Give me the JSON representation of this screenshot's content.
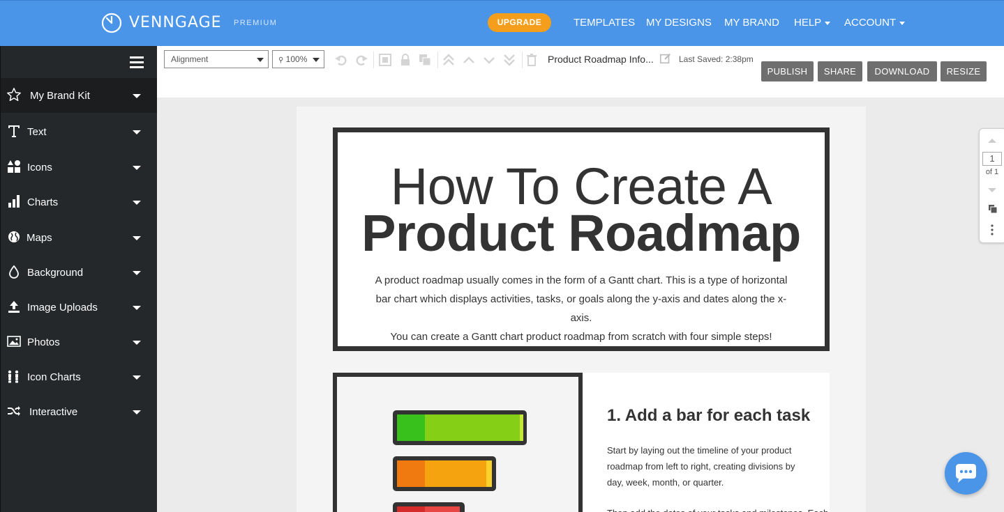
{
  "header": {
    "logo_text": "VENNGAGE",
    "plan_label": "PREMIUM",
    "upgrade_label": "UPGRADE",
    "nav": {
      "templates": "TEMPLATES",
      "my_designs": "MY DESIGNS",
      "my_brand": "MY BRAND",
      "help": "HELP",
      "account": "ACCOUNT"
    },
    "brand_color": "#4a95e8",
    "upgrade_color": "#f59e1b"
  },
  "sidebar": {
    "items": [
      {
        "label": "My Brand Kit",
        "icon": "star-icon"
      },
      {
        "label": "Text",
        "icon": "text-icon"
      },
      {
        "label": "Icons",
        "icon": "shapes-icon"
      },
      {
        "label": "Charts",
        "icon": "bar-chart-icon"
      },
      {
        "label": "Maps",
        "icon": "globe-icon"
      },
      {
        "label": "Background",
        "icon": "droplet-icon"
      },
      {
        "label": "Image Uploads",
        "icon": "upload-icon"
      },
      {
        "label": "Photos",
        "icon": "image-icon"
      },
      {
        "label": "Icon Charts",
        "icon": "people-chart-icon"
      },
      {
        "label": "Interactive",
        "icon": "shuffle-icon"
      }
    ]
  },
  "toolbar": {
    "alignment_value": "Alignment",
    "zoom_value": "100%",
    "doc_title": "Product Roadmap Info...",
    "last_saved": "Last Saved: 2:38pm",
    "publish_label": "PUBLISH",
    "share_label": "SHARE",
    "download_label": "DOWNLOAD",
    "resize_label": "RESIZE"
  },
  "canvas": {
    "hero": {
      "title_line1": "How To Create A",
      "title_line2": "Product Roadmap",
      "paragraph_line1": "A product roadmap usually comes in the form of a Gantt chart. This is a type of horizontal",
      "paragraph_line2": "bar chart which displays activities, tasks, or goals along the y-axis and dates along the x-axis.",
      "paragraph_line3": "You can create a Gantt chart product roadmap from scratch with four simple steps!"
    },
    "step1": {
      "heading": "1. Add a bar for each task",
      "paragraph_line1": "Start by laying out the timeline of your product",
      "paragraph_line2": "roadmap from left to right, creating divisions by",
      "paragraph_line3": "day, week, month, or quarter.",
      "paragraph_cut": "Then add the dates of your tasks and milestones. Each task"
    }
  },
  "pager": {
    "current_page": "1",
    "of_label": "of 1"
  }
}
